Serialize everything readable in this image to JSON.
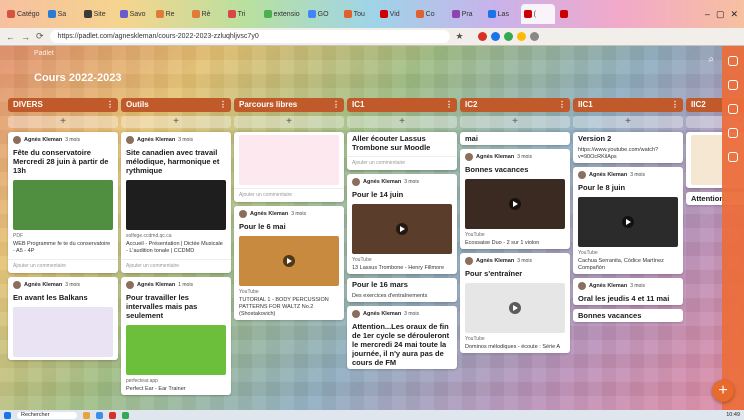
{
  "browser": {
    "tabs": [
      {
        "label": "Catégo",
        "color": "#d4553b"
      },
      {
        "label": "Sa",
        "color": "#2a7bd3"
      },
      {
        "label": "Site",
        "color": "#3c3c3c"
      },
      {
        "label": "Savo",
        "color": "#6a5acd"
      },
      {
        "label": "Re",
        "color": "#e07b39"
      },
      {
        "label": "Rè",
        "color": "#e07b39"
      },
      {
        "label": "Tri",
        "color": "#d44"
      },
      {
        "label": "extensio",
        "color": "#4caf50"
      },
      {
        "label": "GO",
        "color": "#4285f4"
      },
      {
        "label": "Tou",
        "color": "#e06030"
      },
      {
        "label": "Vid",
        "color": "#cc0000"
      },
      {
        "label": "Co",
        "color": "#e06030"
      },
      {
        "label": "Pra",
        "color": "#8e44ad"
      },
      {
        "label": "Las",
        "color": "#1a73e8"
      },
      {
        "label": "(",
        "color": "#cc0000"
      },
      {
        "label": "",
        "color": "#cc0000"
      }
    ],
    "url": "https://padlet.com/agneskleman/cours-2022-2023-zzluqhljvsc7y0"
  },
  "board": {
    "owner": "Padlet",
    "title": "Cours 2022-2023"
  },
  "columns": [
    {
      "name": "DIVERS",
      "cards": [
        {
          "author": "Agnès Kleman",
          "time": "3 mois",
          "title": "Fête du conservatoire Mercredi 28 juin à partir de 13h",
          "body": "",
          "thumb": "#4f8f3f",
          "src": "PDF",
          "caption": "WEB Programme fe te du conservatoire - A5 - 4P",
          "comment": "Ajouter un commentaire"
        },
        {
          "author": "Agnès Kleman",
          "time": "3 mois",
          "title": "En avant les Balkans",
          "body": "",
          "thumb": "#e9e3f3",
          "src": "",
          "caption": "",
          "comment": ""
        }
      ]
    },
    {
      "name": "Outils",
      "cards": [
        {
          "author": "Agnès Kleman",
          "time": "3 mois",
          "title": "Site canadien avec travail mélodique, harmonique et rythmique",
          "body": "",
          "thumb": "#1e1e1e",
          "src": "solfege.ccdmd.qc.ca",
          "caption": "Accueil - Présentation | Dictée Musicale - L'audition tonale | CCDMD",
          "comment": "Ajouter un commentaire"
        },
        {
          "author": "Agnès Kleman",
          "time": "1 mois",
          "title": "Pour travailler les intervalles mais pas seulement",
          "body": "",
          "thumb": "#6cbf3a",
          "src": "perfectear.app",
          "caption": "Perfect Ear - Ear Trainer",
          "comment": ""
        }
      ]
    },
    {
      "name": "Parcours libres",
      "cards": [
        {
          "author": "",
          "time": "",
          "title": "",
          "body": "",
          "thumb": "#fde8ef",
          "src": "",
          "caption": "",
          "comment": "Ajouter un commentaire"
        },
        {
          "author": "Agnès Kleman",
          "time": "3 mois",
          "title": "Pour le 6 mai",
          "body": "",
          "thumb": "#c88a3e",
          "src": "YouTube",
          "caption": "TUTORIAL 1 - BODY PERCUSSION PATTERNS FOR WALTZ No.2 (Shostakovich)",
          "comment": ""
        }
      ]
    },
    {
      "name": "IC1",
      "cards": [
        {
          "author": "",
          "time": "",
          "title": "Aller écouter Lassus Trombone sur Moodle",
          "body": "",
          "thumb": "",
          "src": "",
          "caption": "",
          "comment": "Ajouter un commentaire"
        },
        {
          "author": "Agnès Kleman",
          "time": "3 mois",
          "title": "Pour le 14 juin",
          "body": "",
          "thumb": "#5a3e2b",
          "src": "YouTube",
          "caption": "13 Lassus Trombone - Henry Fillmore",
          "comment": ""
        },
        {
          "author": "Agnès Kleman",
          "time": "3 mois",
          "title": "Attention...Les oraux de fin de 1er cycle se dérouleront le mercredi 24 mai toute la journée, il n'y aura pas de cours de FM",
          "body": "",
          "thumb": "",
          "src": "",
          "caption": "",
          "comment": ""
        }
      ]
    },
    {
      "name": "IC2",
      "cards": [
        {
          "author": "",
          "time": "",
          "title": "mai",
          "body": "",
          "thumb": "",
          "src": "",
          "caption": "",
          "comment": ""
        },
        {
          "author": "Agnès Kleman",
          "time": "3 mois",
          "title": "Bonnes vacances",
          "body": "",
          "thumb": "#3b2a22",
          "src": "YouTube",
          "caption": "Ecossaise Duo - 2 sur 1 violon",
          "comment": ""
        },
        {
          "author": "Agnès Kleman",
          "time": "3 mois",
          "title": "Pour s'entraîner",
          "body": "",
          "thumb": "#e6e6e6",
          "src": "YouTube",
          "caption": "Dominos mélodiques - écoute : Série A",
          "comment": ""
        }
      ]
    },
    {
      "name": "IIC1",
      "cards": [
        {
          "author": "",
          "time": "",
          "title": "Version 2",
          "body": "https://www.youtube.com/watch?v=90OcRKilAps",
          "thumb": "",
          "src": "",
          "caption": "",
          "comment": ""
        },
        {
          "author": "Agnès Kleman",
          "time": "3 mois",
          "title": "Pour le 8 juin",
          "body": "",
          "thumb": "#2b2b2b",
          "src": "YouTube",
          "caption": "Cachua Serranita, Códice Martínez Compañón",
          "comment": ""
        },
        {
          "author": "Agnès Kleman",
          "time": "3 mois",
          "title": "Oral les jeudis 4 et 11 mai",
          "body": "",
          "thumb": "",
          "src": "",
          "caption": "",
          "comment": ""
        }
      ]
    },
    {
      "name": "IIC2",
      "cards": [
        {
          "author": "",
          "time": "",
          "title": "",
          "body": "",
          "thumb": "#f6e7d2",
          "src": "",
          "caption": "",
          "comment": ""
        },
        {
          "author": "",
          "time": "",
          "title": "Attention...",
          "body": "",
          "thumb": "",
          "src": "",
          "caption": "",
          "comment": ""
        }
      ]
    }
  ],
  "extra": {
    "ic1_third_title": "Pour le 16 mars",
    "ic1_third_body": "Des exercices d'entraînements",
    "iic1_fourth_title": "Bonnes vacances"
  },
  "taskbar": {
    "search": "Rechercher",
    "clock": "10:49"
  }
}
